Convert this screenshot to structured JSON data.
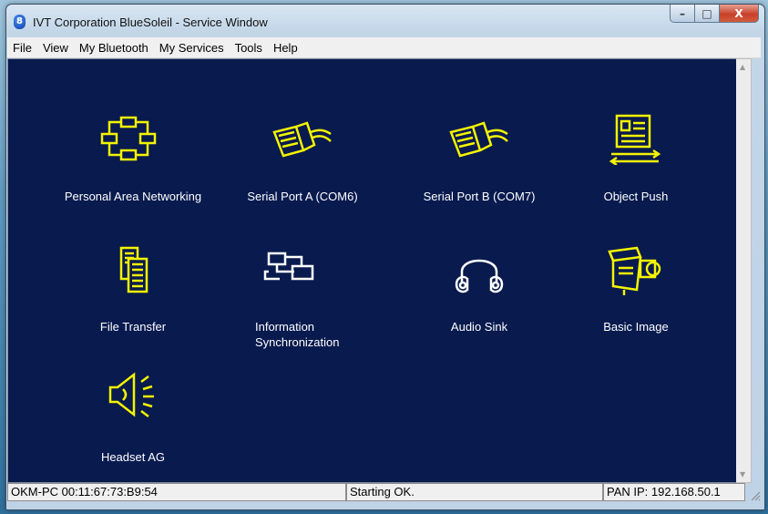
{
  "window": {
    "title": "IVT Corporation BlueSoleil - Service Window",
    "app_icon_glyph": "8",
    "controls": {
      "minimize": "–",
      "maximize": "□",
      "close": "X"
    }
  },
  "menu": [
    "File",
    "View",
    "My Bluetooth",
    "My Services",
    "Tools",
    "Help"
  ],
  "services": [
    {
      "label": "Personal Area Networking",
      "icon": "network-icon"
    },
    {
      "label": "Serial Port A (COM6)",
      "icon": "serial-port-icon"
    },
    {
      "label": "Serial Port B (COM7)",
      "icon": "serial-port-icon"
    },
    {
      "label": "Object Push",
      "icon": "object-push-icon"
    },
    {
      "label": "File Transfer",
      "icon": "file-transfer-icon"
    },
    {
      "label_line1": "Information",
      "label_line2": "Synchronization",
      "icon": "sync-icon"
    },
    {
      "label": "Audio Sink",
      "icon": "headphones-icon"
    },
    {
      "label": "Basic Image",
      "icon": "camera-icon"
    },
    {
      "label": "Headset AG",
      "icon": "speaker-icon"
    }
  ],
  "status": {
    "device": "OKM-PC 00:11:67:73:B9:54",
    "message": "Starting OK.",
    "pan_ip": "PAN IP: 192.168.50.1"
  },
  "colors": {
    "content_bg": "#081a4e",
    "icon_yellow": "#f4f400",
    "label_text": "#ffffff"
  }
}
